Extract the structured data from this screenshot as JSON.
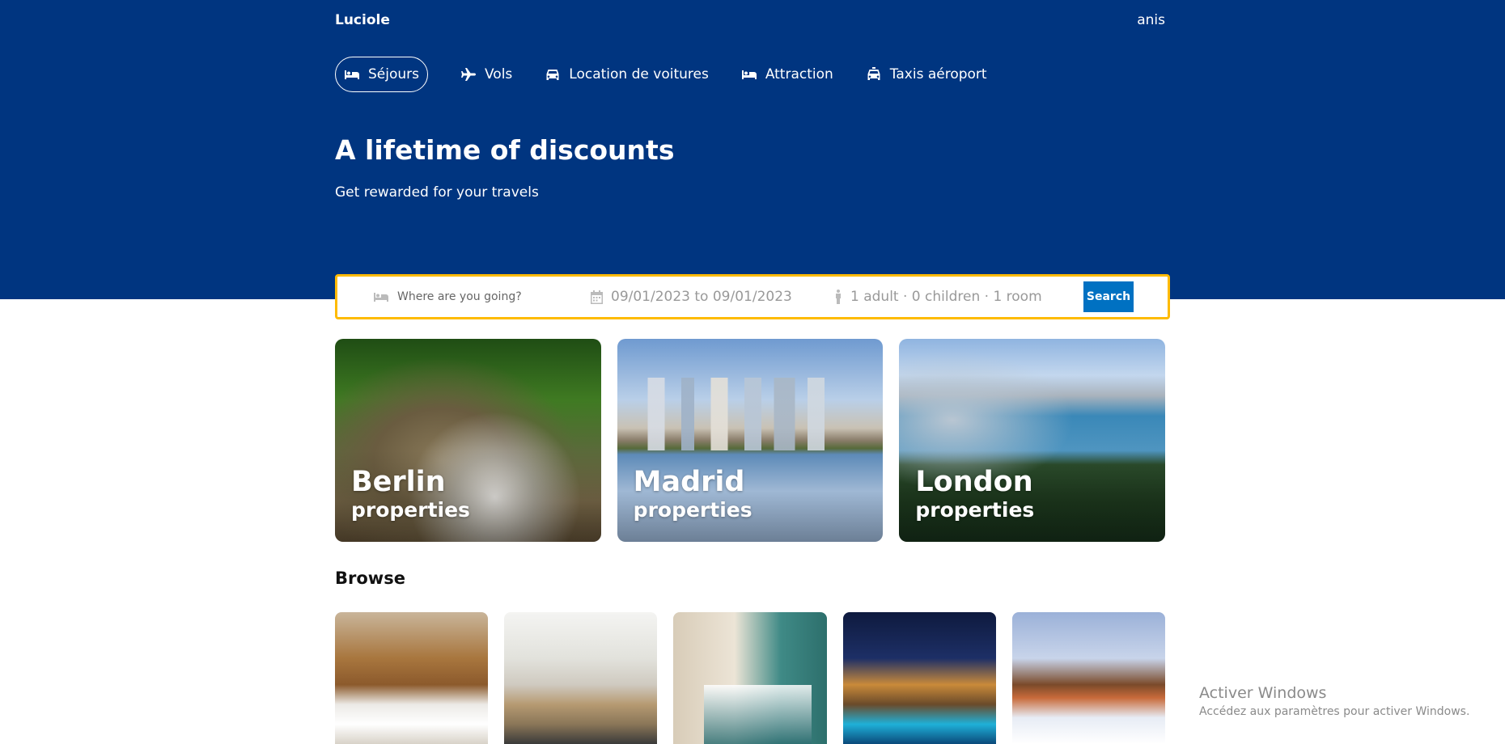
{
  "header": {
    "logo": "Luciole",
    "user": "anis",
    "nav": [
      {
        "label": "Séjours",
        "icon": "bed-icon",
        "active": true
      },
      {
        "label": "Vols",
        "icon": "plane-icon",
        "active": false
      },
      {
        "label": "Location de voitures",
        "icon": "car-icon",
        "active": false
      },
      {
        "label": "Attraction",
        "icon": "bed-icon",
        "active": false
      },
      {
        "label": "Taxis aéroport",
        "icon": "taxi-icon",
        "active": false
      }
    ],
    "title": "A lifetime of discounts",
    "subtitle": "Get rewarded for your travels"
  },
  "search": {
    "destination_placeholder": "Where are you going?",
    "dates": "09/01/2023 to 09/01/2023",
    "guests": "1 adult · 0 children · 1 room",
    "button": "Search"
  },
  "featured": [
    {
      "city": "Berlin",
      "sub": "properties"
    },
    {
      "city": "Madrid",
      "sub": "properties"
    },
    {
      "city": "London",
      "sub": "properties"
    }
  ],
  "browse": {
    "title": "Browse",
    "items": [
      {
        "name": "bedroom-photo"
      },
      {
        "name": "kitchen-photo"
      },
      {
        "name": "suite-photo"
      },
      {
        "name": "villa-photo"
      },
      {
        "name": "chalet-photo"
      }
    ]
  },
  "watermark": {
    "line1": "Activer Windows",
    "line2": "Accédez aux paramètres pour activer Windows."
  },
  "colors": {
    "header_bg": "#003580",
    "search_border": "#febb02",
    "button_bg": "#0071c2"
  }
}
